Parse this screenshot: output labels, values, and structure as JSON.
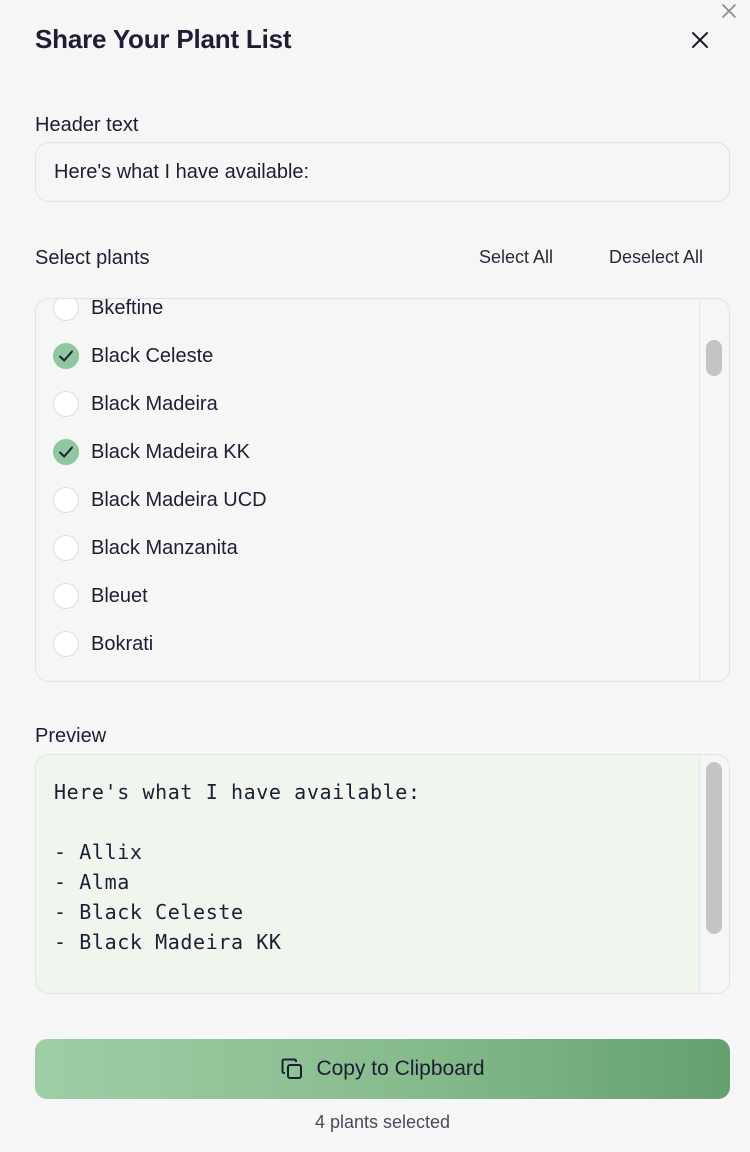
{
  "dialog": {
    "title": "Share Your Plant List"
  },
  "header_field": {
    "label": "Header text",
    "value": "Here's what I have available:"
  },
  "plant_selector": {
    "label": "Select plants",
    "select_all": "Select All",
    "deselect_all": "Deselect All",
    "plants": [
      {
        "name": "Bkeftine",
        "checked": false
      },
      {
        "name": "Black Celeste",
        "checked": true
      },
      {
        "name": "Black Madeira",
        "checked": false
      },
      {
        "name": "Black Madeira KK",
        "checked": true
      },
      {
        "name": "Black Madeira UCD",
        "checked": false
      },
      {
        "name": "Black Manzanita",
        "checked": false
      },
      {
        "name": "Bleuet",
        "checked": false
      },
      {
        "name": "Bokrati",
        "checked": false
      }
    ]
  },
  "preview": {
    "label": "Preview",
    "lines": [
      "Here's what I have available:",
      "",
      "- Allix",
      "- Alma",
      "- Black Celeste",
      "- Black Madeira KK"
    ]
  },
  "footer": {
    "copy_label": "Copy to Clipboard",
    "selected_count": "4 plants selected"
  },
  "colors": {
    "accent_start": "#9fcea6",
    "accent_end": "#64a06d",
    "checked": "#8fc79e",
    "preview_bg": "#eef6ed"
  },
  "icons": {
    "close": "close-icon",
    "check": "check-icon",
    "copy": "copy-icon"
  }
}
